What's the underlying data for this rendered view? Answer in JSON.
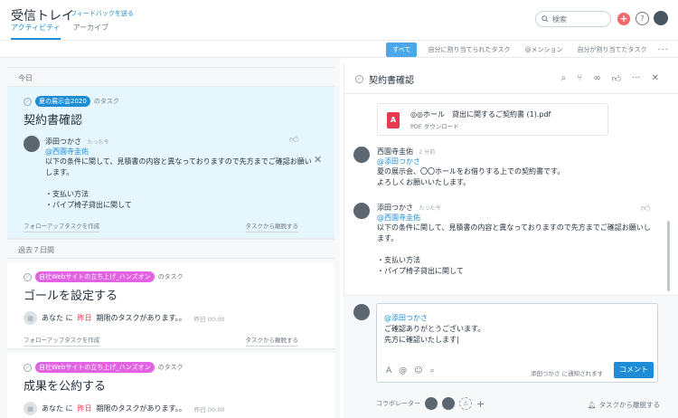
{
  "header": {
    "title": "受信トレイ",
    "feedback": "フィードバックを送る",
    "tabs": [
      {
        "label": "アクティビティ",
        "active": true
      },
      {
        "label": "アーカイブ",
        "active": false
      }
    ],
    "search_placeholder": "検索",
    "plus_icon": "+",
    "help_icon": "?"
  },
  "filters": {
    "items": [
      {
        "label": "すべて",
        "active": true
      },
      {
        "label": "自分に割り当てられたタスク",
        "active": false
      },
      {
        "label": "@メンション",
        "active": false
      },
      {
        "label": "自分が割り当てたタスク",
        "active": false
      }
    ],
    "more": "···"
  },
  "left": {
    "today_label": "今日",
    "past_label": "過去７日間",
    "card1": {
      "project": "夏の展示会2020",
      "of_task": "のタスク",
      "title": "契約書確認",
      "comment": {
        "author": "添田つかさ",
        "time": "たった今",
        "mention": "@西園寺圭佑",
        "body": "以下の条件に関して、見積書の内容と異なっておりますので先方までご確認お願いします。\n\n・支払い方法\n・パイプ椅子貸出に関して"
      },
      "follow_up": "フォローアップタスクを作成",
      "leave": "タスクから離脱する"
    },
    "card2": {
      "project": "自社Webサイトの立ち上げ_ハンズオン",
      "of_task": "のタスク",
      "title": "ゴールを設定する",
      "due_prefix": "あなた に",
      "due_yesterday": "昨日",
      "due_suffix": "期限のタスクがあります。。",
      "due_time": "昨日 00:00",
      "follow_up": "フォローアップタスクを作成",
      "leave": "タスクから離脱する"
    },
    "card3": {
      "project": "自社Webサイトの立ち上げ_ハンズオン",
      "of_task": "のタスク",
      "title": "成果を公約する",
      "due_prefix": "あなた に",
      "due_yesterday": "昨日",
      "due_suffix": "期限のタスクがあります。。",
      "due_time": "昨日 00:00"
    }
  },
  "panel": {
    "title": "契約書確認",
    "attachment": {
      "name": "◎◎ホール　貸出に関するご契約書 (1).pdf",
      "type": "PDF",
      "download": "ダウンロード",
      "icon_label": "A"
    },
    "comments": [
      {
        "author": "西園寺圭佑",
        "time": "2 分前",
        "mention": "@添田つかさ",
        "body": "夏の展示会、〇〇ホールをお借りする上での契約書です。\nよろしくお願いいたします。"
      },
      {
        "author": "添田つかさ",
        "time": "たった今",
        "mention": "@西園寺圭佑",
        "body": "以下の条件に関して、見積書の内容と異なっておりますので先方までご確認お願いします。\n\n・支払い方法\n・パイプ椅子貸出に関して"
      }
    ],
    "compose": {
      "mention": "@添田つかさ",
      "text": "ご確認ありがとうございます。\n先方に確認いたします|",
      "notify": "添田つかさ に通知されます",
      "submit": "コメント"
    },
    "collaborators_label": "コラボレーター",
    "leave": "タスクから離脱する"
  }
}
